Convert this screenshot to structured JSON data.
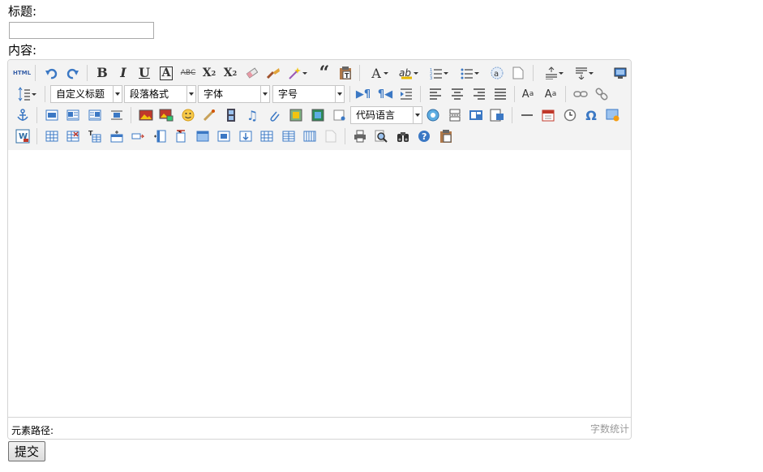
{
  "form": {
    "title_label": "标题:",
    "title_value": "",
    "content_label": "内容:",
    "submit_label": "提交"
  },
  "toolbar": {
    "custom_title": "自定义标题",
    "paragraph_format": "段落格式",
    "font_family": "字体",
    "font_size": "字号",
    "code_language": "代码语言",
    "html_text": "HTML"
  },
  "statusbar": {
    "element_path": "元素路径:",
    "word_count": "字数统计"
  },
  "icons": [
    "html-source-icon",
    "undo-icon",
    "redo-icon",
    "bold-icon",
    "italic-icon",
    "underline-icon",
    "font-border-icon",
    "strikethrough-icon",
    "superscript-icon",
    "subscript-icon",
    "remove-format-icon",
    "format-match-icon",
    "auto-typeset-icon",
    "blockquote-icon",
    "paste-plain-icon",
    "font-color-icon",
    "background-color-icon",
    "ordered-list-icon",
    "unordered-list-icon",
    "select-all-icon",
    "clear-doc-icon",
    "row-spacing-top-icon",
    "row-spacing-bottom-icon",
    "preview-icon",
    "line-height-icon",
    "direction-ltr-icon",
    "direction-rtl-icon",
    "indent-icon",
    "justify-left-icon",
    "justify-center-icon",
    "justify-right-icon",
    "justify-justify-icon",
    "to-uppercase-icon",
    "to-lowercase-icon",
    "link-icon",
    "unlink-icon",
    "anchor-icon",
    "image-none-icon",
    "image-left-icon",
    "image-right-icon",
    "image-center-icon",
    "simple-upload-icon",
    "insert-image-icon",
    "emotion-icon",
    "scrawl-icon",
    "insert-video-icon",
    "music-icon",
    "attachment-icon",
    "map-icon",
    "gmap-icon",
    "insert-frame-icon",
    "page-break-icon",
    "background-icon",
    "template-icon",
    "horizontal-icon",
    "date-icon",
    "time-icon",
    "special-chars-icon",
    "word-image-icon",
    "insert-table-icon",
    "delete-table-icon",
    "insert-caption-icon",
    "insert-row-icon",
    "insert-col-icon",
    "merge-cells-icon",
    "split-cells-icon",
    "print-icon",
    "preview-doc-icon",
    "search-replace-icon",
    "help-icon",
    "drafts-icon"
  ]
}
